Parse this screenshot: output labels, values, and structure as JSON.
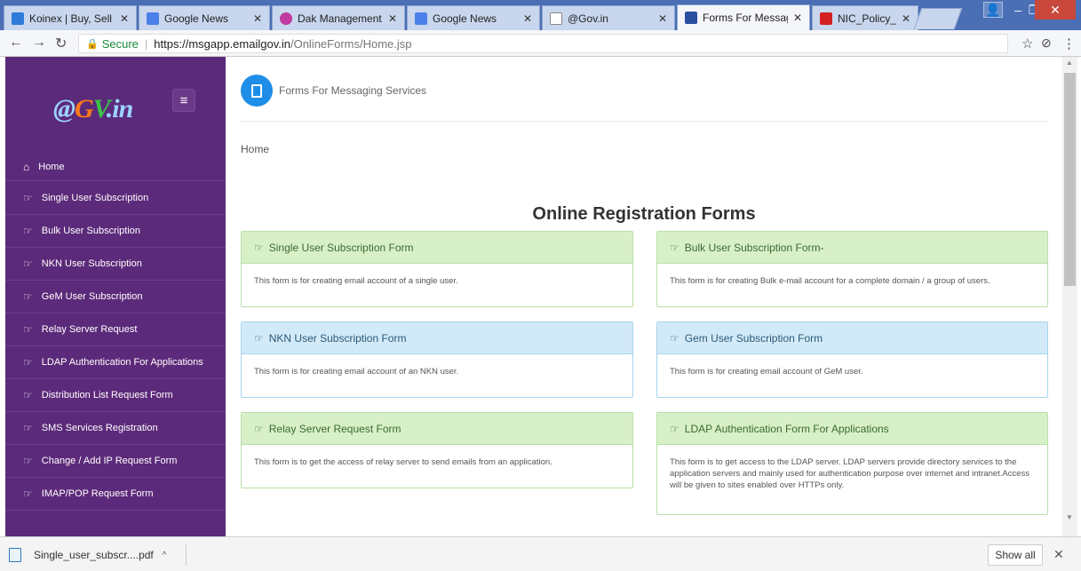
{
  "browser": {
    "tabs": [
      {
        "title": "Koinex | Buy, Sell an",
        "fav_color": "#2c7bd8"
      },
      {
        "title": "Google News",
        "fav_color": "#4a80e8"
      },
      {
        "title": "Dak Management",
        "fav_color": "#c03aa0"
      },
      {
        "title": "Google News",
        "fav_color": "#4a80e8"
      },
      {
        "title": "@Gov.in",
        "fav_color": "#ffffff"
      },
      {
        "title": "Forms For Messagin",
        "fav_color": "#2a4fa0"
      },
      {
        "title": "NIC_Policy_on_form",
        "fav_color": "#d42020"
      }
    ],
    "address": {
      "secure_label": "Secure",
      "host": "https://msgapp.emailgov.in",
      "path": "/OnlineForms/Home.jsp"
    }
  },
  "sidebar": {
    "logo": {
      "part1": "@",
      "part2": "G",
      "part3": "V",
      "part4": ".in"
    },
    "home_label": "Home",
    "items": [
      "Single User Subscription",
      "Bulk User Subscription",
      "NKN User Subscription",
      "GeM User Subscription",
      "Relay Server Request",
      "LDAP Authentication For Applications",
      "Distribution List Request Form",
      "SMS Services Registration",
      "Change / Add IP Request Form",
      "IMAP/POP Request Form"
    ]
  },
  "header": {
    "title": "Forms For Messaging Services"
  },
  "breadcrumb": "Home",
  "main": {
    "title": "Online Registration Forms",
    "cards": [
      {
        "title": "Single User Subscription Form",
        "desc": "This form is for creating email account of a single user.",
        "style": "green"
      },
      {
        "title": "Bulk User Subscription Form-",
        "desc": "This form is for creating Bulk e-mail account for a complete domain / a group of users.",
        "style": "green"
      },
      {
        "title": "NKN User Subscription Form",
        "desc": "This form is for creating email account of an NKN user.",
        "style": "blue"
      },
      {
        "title": "Gem User Subscription Form",
        "desc": "This form is for creating email account of GeM user.",
        "style": "blue"
      },
      {
        "title": "Relay Server Request Form",
        "desc": "This form is to get the access of relay server to send emails from an application.",
        "style": "green"
      },
      {
        "title": "LDAP Authentication Form For Applications",
        "desc": "This form is to get access to the LDAP server. LDAP servers provide directory services to the application servers and mainly used for authentication purpose over internet and intranet.Access will be given to sites enabled over HTTPs only.",
        "style": "green"
      }
    ]
  },
  "downloads": {
    "file": "Single_user_subscr....pdf",
    "show_all": "Show all"
  }
}
